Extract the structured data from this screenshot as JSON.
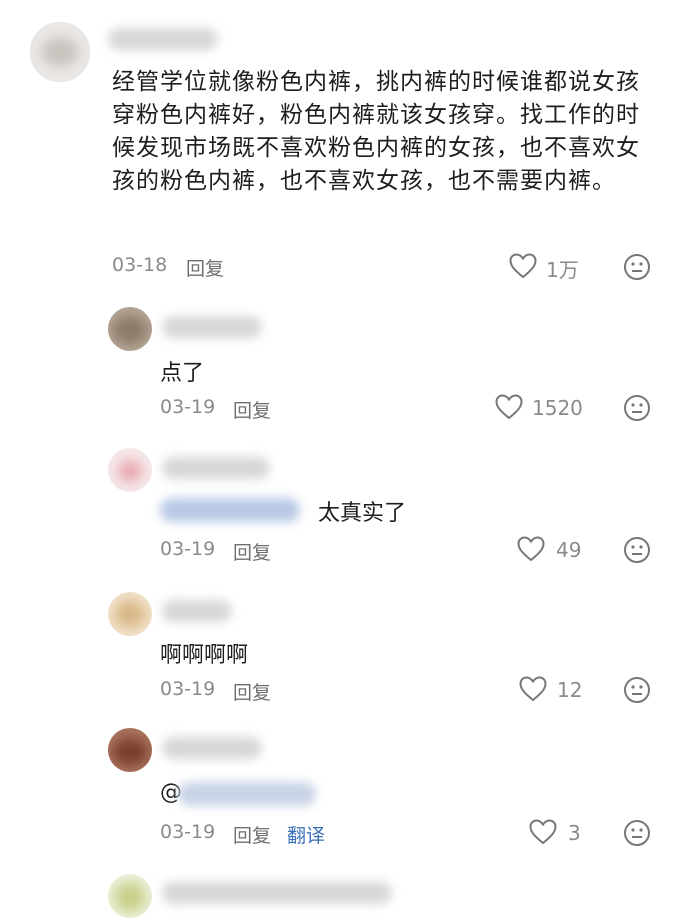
{
  "comment": {
    "text": "经管学位就像粉色内裤，挑内裤的时候谁都说女孩穿粉色内裤好，粉色内裤就该女孩穿。找工作的时候发现市场既不喜欢粉色内裤的女孩，也不喜欢女孩的粉色内裤，也不喜欢女孩，也不需要内裤。",
    "date": "03-18",
    "reply_label": "回复",
    "likes": "1万"
  },
  "replies": [
    {
      "text": "点了",
      "date": "03-19",
      "reply_label": "回复",
      "likes": "1520"
    },
    {
      "text": "太真实了",
      "date": "03-19",
      "reply_label": "回复",
      "likes": "49"
    },
    {
      "text": "啊啊啊啊",
      "date": "03-19",
      "reply_label": "回复",
      "likes": "12"
    },
    {
      "mention_prefix": "@",
      "date": "03-19",
      "reply_label": "回复",
      "translate_label": "翻译",
      "likes": "3"
    }
  ],
  "icons": {
    "like": "heart-outline-icon",
    "dislike": "neutral-face-icon"
  },
  "colors": {
    "text": "#1e1e1e",
    "meta": "#8a8a8a",
    "link": "#3b6fb6",
    "background": "#ffffff"
  }
}
